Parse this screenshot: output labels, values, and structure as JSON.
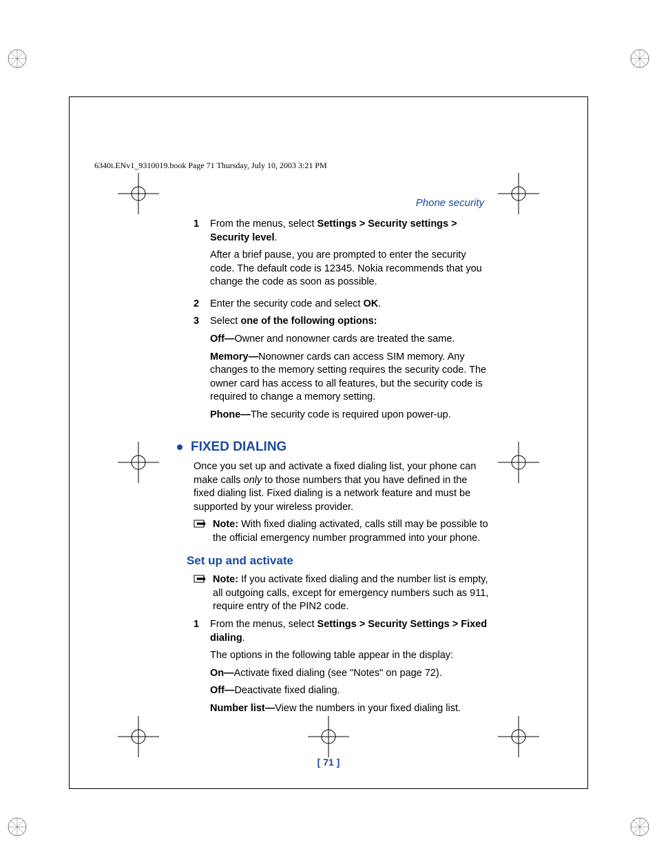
{
  "header": "6340i.ENv1_9310019.book  Page 71  Thursday, July 10, 2003  3:21 PM",
  "running_head": "Phone security",
  "page_number": "[ 71 ]",
  "steps_a": [
    {
      "n": "1",
      "lead": "From the menus, select ",
      "bold1": "Settings > Security settings > Security level",
      "tail": ".",
      "after": "After a brief pause, you are prompted to enter the security code. The default code is 12345. Nokia recommends that you change the code as soon as possible."
    },
    {
      "n": "2",
      "lead": "Enter the security code and select ",
      "bold1": "OK",
      "tail": "."
    },
    {
      "n": "3",
      "lead": "Select ",
      "bold1": "one of the following options:",
      "tail": "",
      "defs": [
        {
          "term": "Off—",
          "body": "Owner and nonowner cards are treated the same."
        },
        {
          "term": "Memory—",
          "body": "Nonowner cards can access SIM memory. Any changes to the memory setting requires the security code. The owner card has access to all features, but the security code is required to change a memory setting."
        },
        {
          "term": "Phone—",
          "body": "The security code is required upon power-up."
        }
      ]
    }
  ],
  "h2": "FIXED DIALING",
  "fixed_intro_a": "Once you set up and activate a fixed dialing list, your phone can make calls ",
  "fixed_intro_em": "only",
  "fixed_intro_b": " to those numbers that you have defined in the fixed dialing list. Fixed dialing is a network feature and must be supported by your wireless provider.",
  "note1_label": "Note:",
  "note1_body": " With fixed dialing activated, calls still may be possible to the official emergency number programmed into your phone.",
  "h3": "Set up and activate",
  "note2_label": "Note:",
  "note2_body": " If you activate fixed dialing and the number list is empty, all outgoing calls, except for emergency numbers such as 911, require entry of the PIN2 code.",
  "steps_b": [
    {
      "n": "1",
      "lead": "From the menus, select ",
      "bold1": "Settings > Security Settings > Fixed dialing",
      "tail": ".",
      "after": "The options in the following table appear in the display:",
      "defs": [
        {
          "term": "On—",
          "body": "Activate fixed dialing (see \"Notes\" on page 72)."
        },
        {
          "term": "Off—",
          "body": "Deactivate fixed dialing."
        },
        {
          "term": "Number list—",
          "body": "View the numbers in your fixed dialing list."
        }
      ]
    }
  ]
}
